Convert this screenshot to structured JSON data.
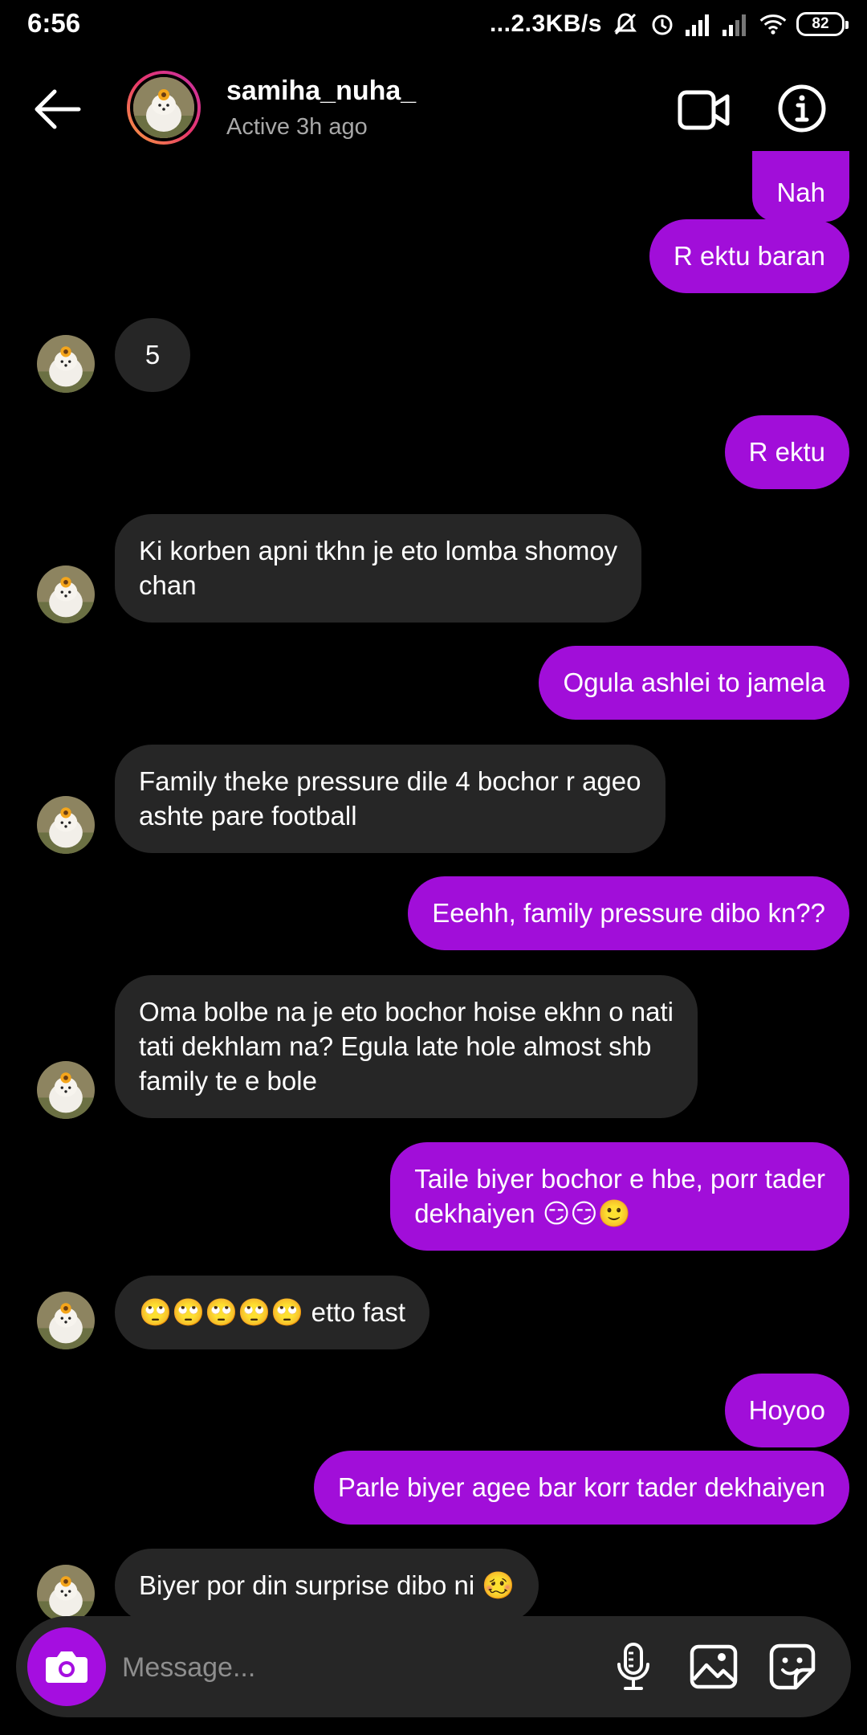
{
  "status_bar": {
    "time": "6:56",
    "net_speed": "...2.3KB/s",
    "battery": "82",
    "icons": [
      "mute-icon",
      "alarm-icon",
      "signal-icon",
      "signal-icon",
      "wifi-icon",
      "battery-icon"
    ]
  },
  "header": {
    "username": "samiha_nuha_",
    "activity": "Active 3h ago",
    "icons": [
      "back-arrow-icon",
      "video-call-icon",
      "info-icon"
    ]
  },
  "colors": {
    "outgoing_bubble": "#a10ed9",
    "incoming_bubble": "#262626",
    "background": "#000000"
  },
  "messages": [
    {
      "side": "out",
      "text": "Nah"
    },
    {
      "side": "out",
      "text": "R ektu baran"
    },
    {
      "side": "in",
      "text": "5"
    },
    {
      "side": "out",
      "text": "R ektu"
    },
    {
      "side": "in",
      "text": "Ki korben apni tkhn je eto lomba shomoy\nchan"
    },
    {
      "side": "out",
      "text": "Ogula ashlei to jamela"
    },
    {
      "side": "in",
      "text": "Family theke pressure dile 4 bochor r ageo\nashte pare football"
    },
    {
      "side": "out",
      "text": "Eeehh, family pressure dibo kn??"
    },
    {
      "side": "in",
      "text": "Oma bolbe na je eto bochor hoise ekhn o nati\ntati dekhlam na? Egula late hole almost shb\nfamily te e bole"
    },
    {
      "side": "out",
      "text": "Taile biyer bochor e hbe, porr tader\ndekhaiyen 😏😏🙂"
    },
    {
      "side": "in",
      "text": "🙄🙄🙄🙄🙄 etto fast"
    },
    {
      "side": "out",
      "text": "Hoyoo"
    },
    {
      "side": "out",
      "text": "Parle biyer agee bar korr tader dekhaiyen"
    },
    {
      "side": "in",
      "text": "Biyer por din surprise dibo ni 🥴"
    }
  ],
  "composer": {
    "placeholder": "Message...",
    "icons": [
      "camera-icon",
      "microphone-icon",
      "gallery-icon",
      "sticker-icon"
    ]
  }
}
